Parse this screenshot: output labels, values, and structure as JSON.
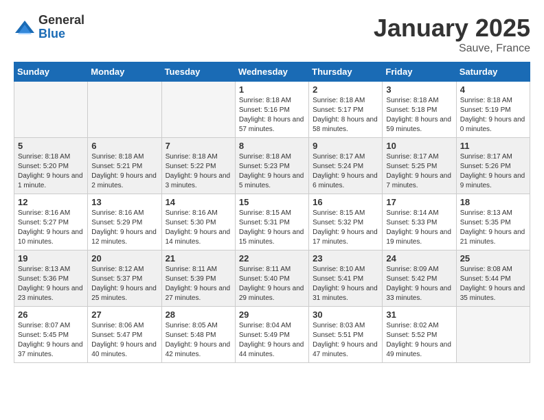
{
  "header": {
    "logo_general": "General",
    "logo_blue": "Blue",
    "month_title": "January 2025",
    "location": "Sauve, France"
  },
  "weekdays": [
    "Sunday",
    "Monday",
    "Tuesday",
    "Wednesday",
    "Thursday",
    "Friday",
    "Saturday"
  ],
  "weeks": [
    [
      {
        "day": "",
        "sunrise": "",
        "sunset": "",
        "daylight": "",
        "empty": true
      },
      {
        "day": "",
        "sunrise": "",
        "sunset": "",
        "daylight": "",
        "empty": true
      },
      {
        "day": "",
        "sunrise": "",
        "sunset": "",
        "daylight": "",
        "empty": true
      },
      {
        "day": "1",
        "sunrise": "Sunrise: 8:18 AM",
        "sunset": "Sunset: 5:16 PM",
        "daylight": "Daylight: 8 hours and 57 minutes.",
        "empty": false
      },
      {
        "day": "2",
        "sunrise": "Sunrise: 8:18 AM",
        "sunset": "Sunset: 5:17 PM",
        "daylight": "Daylight: 8 hours and 58 minutes.",
        "empty": false
      },
      {
        "day": "3",
        "sunrise": "Sunrise: 8:18 AM",
        "sunset": "Sunset: 5:18 PM",
        "daylight": "Daylight: 8 hours and 59 minutes.",
        "empty": false
      },
      {
        "day": "4",
        "sunrise": "Sunrise: 8:18 AM",
        "sunset": "Sunset: 5:19 PM",
        "daylight": "Daylight: 9 hours and 0 minutes.",
        "empty": false
      }
    ],
    [
      {
        "day": "5",
        "sunrise": "Sunrise: 8:18 AM",
        "sunset": "Sunset: 5:20 PM",
        "daylight": "Daylight: 9 hours and 1 minute.",
        "empty": false
      },
      {
        "day": "6",
        "sunrise": "Sunrise: 8:18 AM",
        "sunset": "Sunset: 5:21 PM",
        "daylight": "Daylight: 9 hours and 2 minutes.",
        "empty": false
      },
      {
        "day": "7",
        "sunrise": "Sunrise: 8:18 AM",
        "sunset": "Sunset: 5:22 PM",
        "daylight": "Daylight: 9 hours and 3 minutes.",
        "empty": false
      },
      {
        "day": "8",
        "sunrise": "Sunrise: 8:18 AM",
        "sunset": "Sunset: 5:23 PM",
        "daylight": "Daylight: 9 hours and 5 minutes.",
        "empty": false
      },
      {
        "day": "9",
        "sunrise": "Sunrise: 8:17 AM",
        "sunset": "Sunset: 5:24 PM",
        "daylight": "Daylight: 9 hours and 6 minutes.",
        "empty": false
      },
      {
        "day": "10",
        "sunrise": "Sunrise: 8:17 AM",
        "sunset": "Sunset: 5:25 PM",
        "daylight": "Daylight: 9 hours and 7 minutes.",
        "empty": false
      },
      {
        "day": "11",
        "sunrise": "Sunrise: 8:17 AM",
        "sunset": "Sunset: 5:26 PM",
        "daylight": "Daylight: 9 hours and 9 minutes.",
        "empty": false
      }
    ],
    [
      {
        "day": "12",
        "sunrise": "Sunrise: 8:16 AM",
        "sunset": "Sunset: 5:27 PM",
        "daylight": "Daylight: 9 hours and 10 minutes.",
        "empty": false
      },
      {
        "day": "13",
        "sunrise": "Sunrise: 8:16 AM",
        "sunset": "Sunset: 5:29 PM",
        "daylight": "Daylight: 9 hours and 12 minutes.",
        "empty": false
      },
      {
        "day": "14",
        "sunrise": "Sunrise: 8:16 AM",
        "sunset": "Sunset: 5:30 PM",
        "daylight": "Daylight: 9 hours and 14 minutes.",
        "empty": false
      },
      {
        "day": "15",
        "sunrise": "Sunrise: 8:15 AM",
        "sunset": "Sunset: 5:31 PM",
        "daylight": "Daylight: 9 hours and 15 minutes.",
        "empty": false
      },
      {
        "day": "16",
        "sunrise": "Sunrise: 8:15 AM",
        "sunset": "Sunset: 5:32 PM",
        "daylight": "Daylight: 9 hours and 17 minutes.",
        "empty": false
      },
      {
        "day": "17",
        "sunrise": "Sunrise: 8:14 AM",
        "sunset": "Sunset: 5:33 PM",
        "daylight": "Daylight: 9 hours and 19 minutes.",
        "empty": false
      },
      {
        "day": "18",
        "sunrise": "Sunrise: 8:13 AM",
        "sunset": "Sunset: 5:35 PM",
        "daylight": "Daylight: 9 hours and 21 minutes.",
        "empty": false
      }
    ],
    [
      {
        "day": "19",
        "sunrise": "Sunrise: 8:13 AM",
        "sunset": "Sunset: 5:36 PM",
        "daylight": "Daylight: 9 hours and 23 minutes.",
        "empty": false
      },
      {
        "day": "20",
        "sunrise": "Sunrise: 8:12 AM",
        "sunset": "Sunset: 5:37 PM",
        "daylight": "Daylight: 9 hours and 25 minutes.",
        "empty": false
      },
      {
        "day": "21",
        "sunrise": "Sunrise: 8:11 AM",
        "sunset": "Sunset: 5:39 PM",
        "daylight": "Daylight: 9 hours and 27 minutes.",
        "empty": false
      },
      {
        "day": "22",
        "sunrise": "Sunrise: 8:11 AM",
        "sunset": "Sunset: 5:40 PM",
        "daylight": "Daylight: 9 hours and 29 minutes.",
        "empty": false
      },
      {
        "day": "23",
        "sunrise": "Sunrise: 8:10 AM",
        "sunset": "Sunset: 5:41 PM",
        "daylight": "Daylight: 9 hours and 31 minutes.",
        "empty": false
      },
      {
        "day": "24",
        "sunrise": "Sunrise: 8:09 AM",
        "sunset": "Sunset: 5:42 PM",
        "daylight": "Daylight: 9 hours and 33 minutes.",
        "empty": false
      },
      {
        "day": "25",
        "sunrise": "Sunrise: 8:08 AM",
        "sunset": "Sunset: 5:44 PM",
        "daylight": "Daylight: 9 hours and 35 minutes.",
        "empty": false
      }
    ],
    [
      {
        "day": "26",
        "sunrise": "Sunrise: 8:07 AM",
        "sunset": "Sunset: 5:45 PM",
        "daylight": "Daylight: 9 hours and 37 minutes.",
        "empty": false
      },
      {
        "day": "27",
        "sunrise": "Sunrise: 8:06 AM",
        "sunset": "Sunset: 5:47 PM",
        "daylight": "Daylight: 9 hours and 40 minutes.",
        "empty": false
      },
      {
        "day": "28",
        "sunrise": "Sunrise: 8:05 AM",
        "sunset": "Sunset: 5:48 PM",
        "daylight": "Daylight: 9 hours and 42 minutes.",
        "empty": false
      },
      {
        "day": "29",
        "sunrise": "Sunrise: 8:04 AM",
        "sunset": "Sunset: 5:49 PM",
        "daylight": "Daylight: 9 hours and 44 minutes.",
        "empty": false
      },
      {
        "day": "30",
        "sunrise": "Sunrise: 8:03 AM",
        "sunset": "Sunset: 5:51 PM",
        "daylight": "Daylight: 9 hours and 47 minutes.",
        "empty": false
      },
      {
        "day": "31",
        "sunrise": "Sunrise: 8:02 AM",
        "sunset": "Sunset: 5:52 PM",
        "daylight": "Daylight: 9 hours and 49 minutes.",
        "empty": false
      },
      {
        "day": "",
        "sunrise": "",
        "sunset": "",
        "daylight": "",
        "empty": true
      }
    ]
  ]
}
